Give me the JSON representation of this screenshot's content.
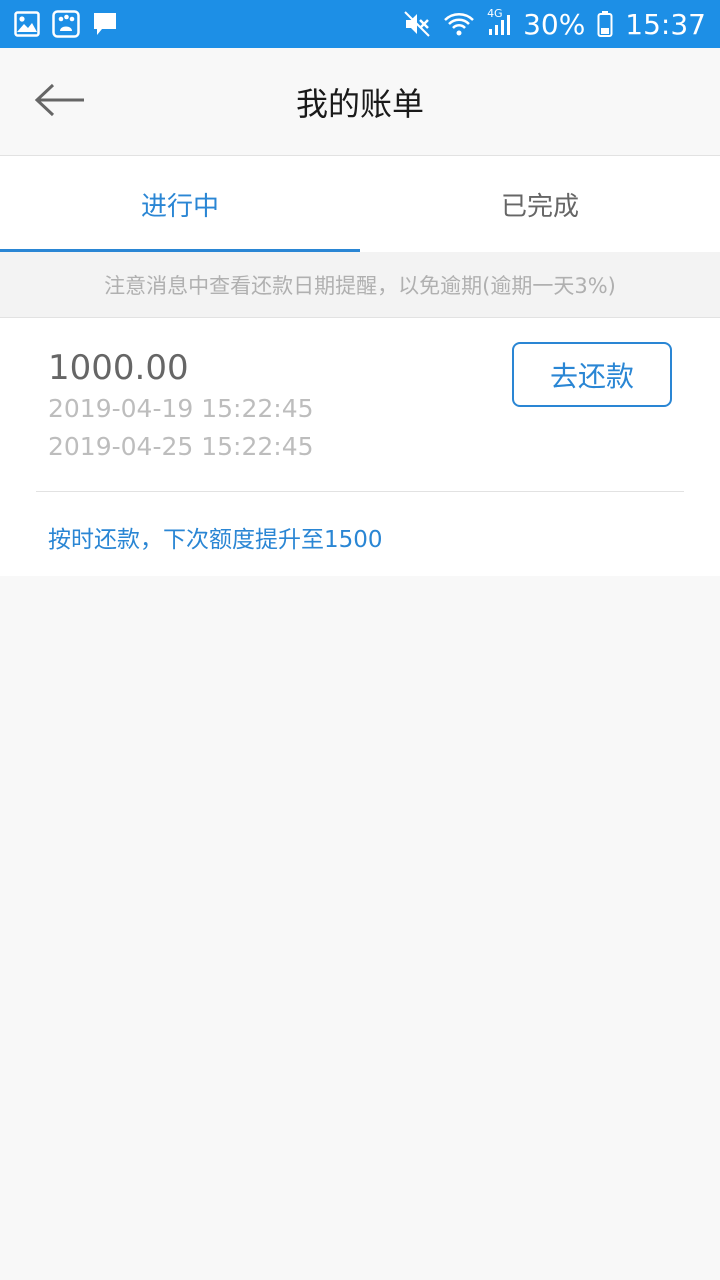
{
  "status_bar": {
    "icons_left": [
      "gallery-icon",
      "baidu-icon",
      "message-icon"
    ],
    "icons_right": [
      "mute-icon",
      "wifi-icon",
      "signal-4g-icon",
      "battery-icon"
    ],
    "network_label": "4G",
    "battery": "30%",
    "time": "15:37",
    "bg_color": "#1d8fe6"
  },
  "header": {
    "title": "我的账单"
  },
  "tabs": [
    {
      "label": "进行中",
      "active": true
    },
    {
      "label": "已完成",
      "active": false
    }
  ],
  "notice": "注意消息中查看还款日期提醒，以免逾期(逾期一天3%)",
  "bill": {
    "amount": "1000.00",
    "start_time": "2019-04-19 15:22:45",
    "due_time": "2019-04-25 15:22:45",
    "repay_label": "去还款",
    "promo": "按时还款，下次额度提升至1500"
  },
  "colors": {
    "accent": "#2a86d4",
    "background": "#f8f8f8"
  }
}
